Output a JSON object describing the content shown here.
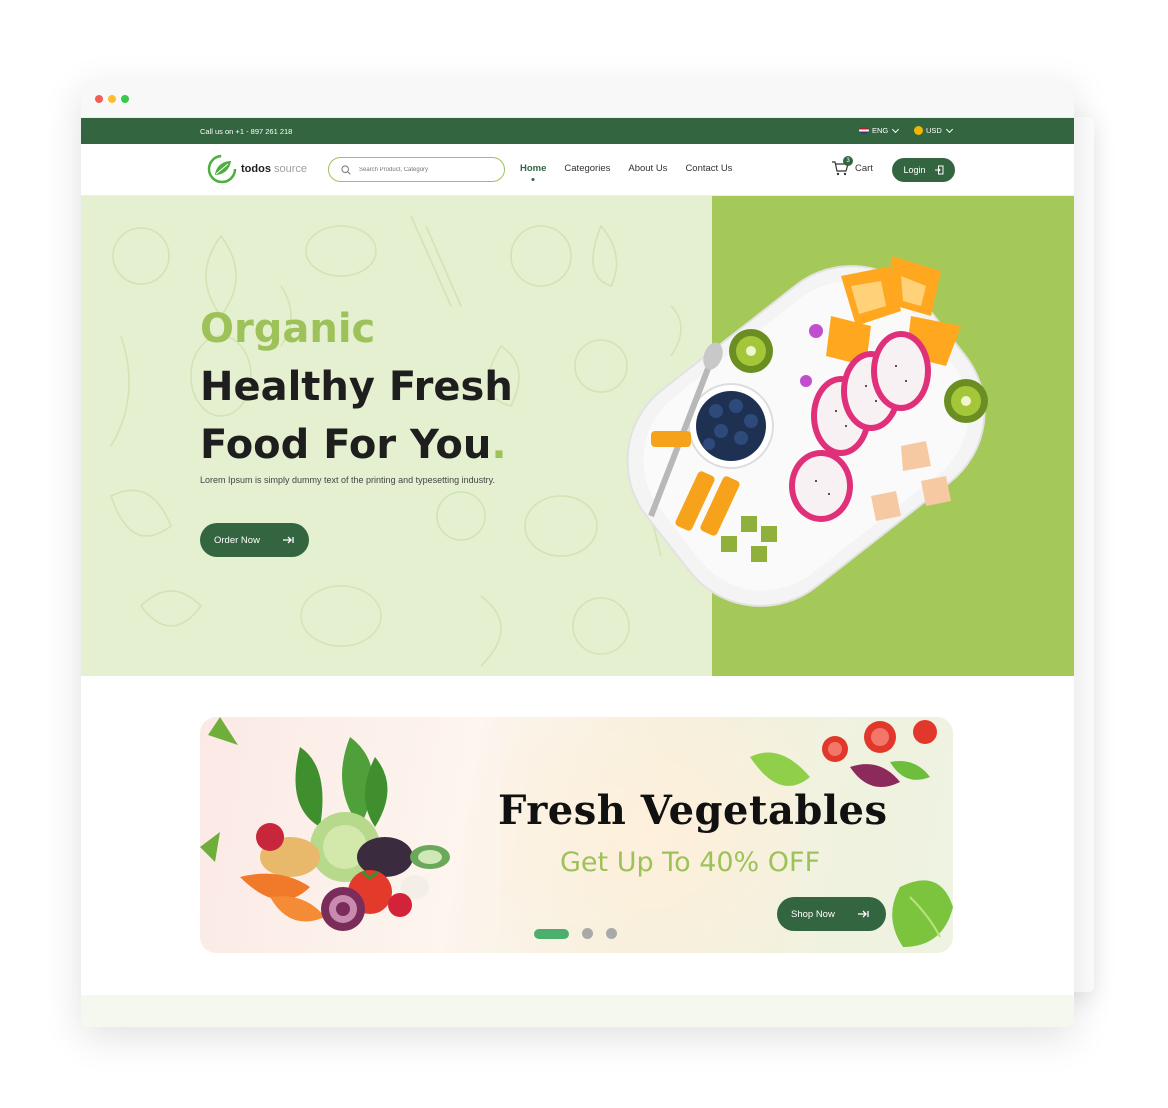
{
  "topbar": {
    "call_text": "Call us on +1 - 897 261 218",
    "language": "ENG",
    "currency": "USD"
  },
  "nav": {
    "brand_bold": "todos",
    "brand_light": "source",
    "search_placeholder": "Search Product, Category",
    "links": [
      "Home",
      "Categories",
      "About Us",
      "Contact Us"
    ],
    "active_link": "Home",
    "cart_label": "Cart",
    "cart_count": "3",
    "login_label": "Login"
  },
  "hero": {
    "title_line1": "Organic",
    "title_line2": "Healthy Fresh",
    "title_line3": "Food For You",
    "title_period": ".",
    "subtitle": "Lorem Ipsum is simply dummy text of the printing and typesetting industry.",
    "cta_label": "Order Now"
  },
  "banner": {
    "title": "Fresh Vegetables",
    "subtitle": "Get Up To 40% OFF",
    "cta_label": "Shop Now",
    "active_slide": 1,
    "slide_count": 3
  },
  "colors": {
    "brand_dark_green": "#336640",
    "accent_light_green": "#9ec25a",
    "hero_bg": "#e4f0d0",
    "hero_right_bg": "#a5c958"
  }
}
